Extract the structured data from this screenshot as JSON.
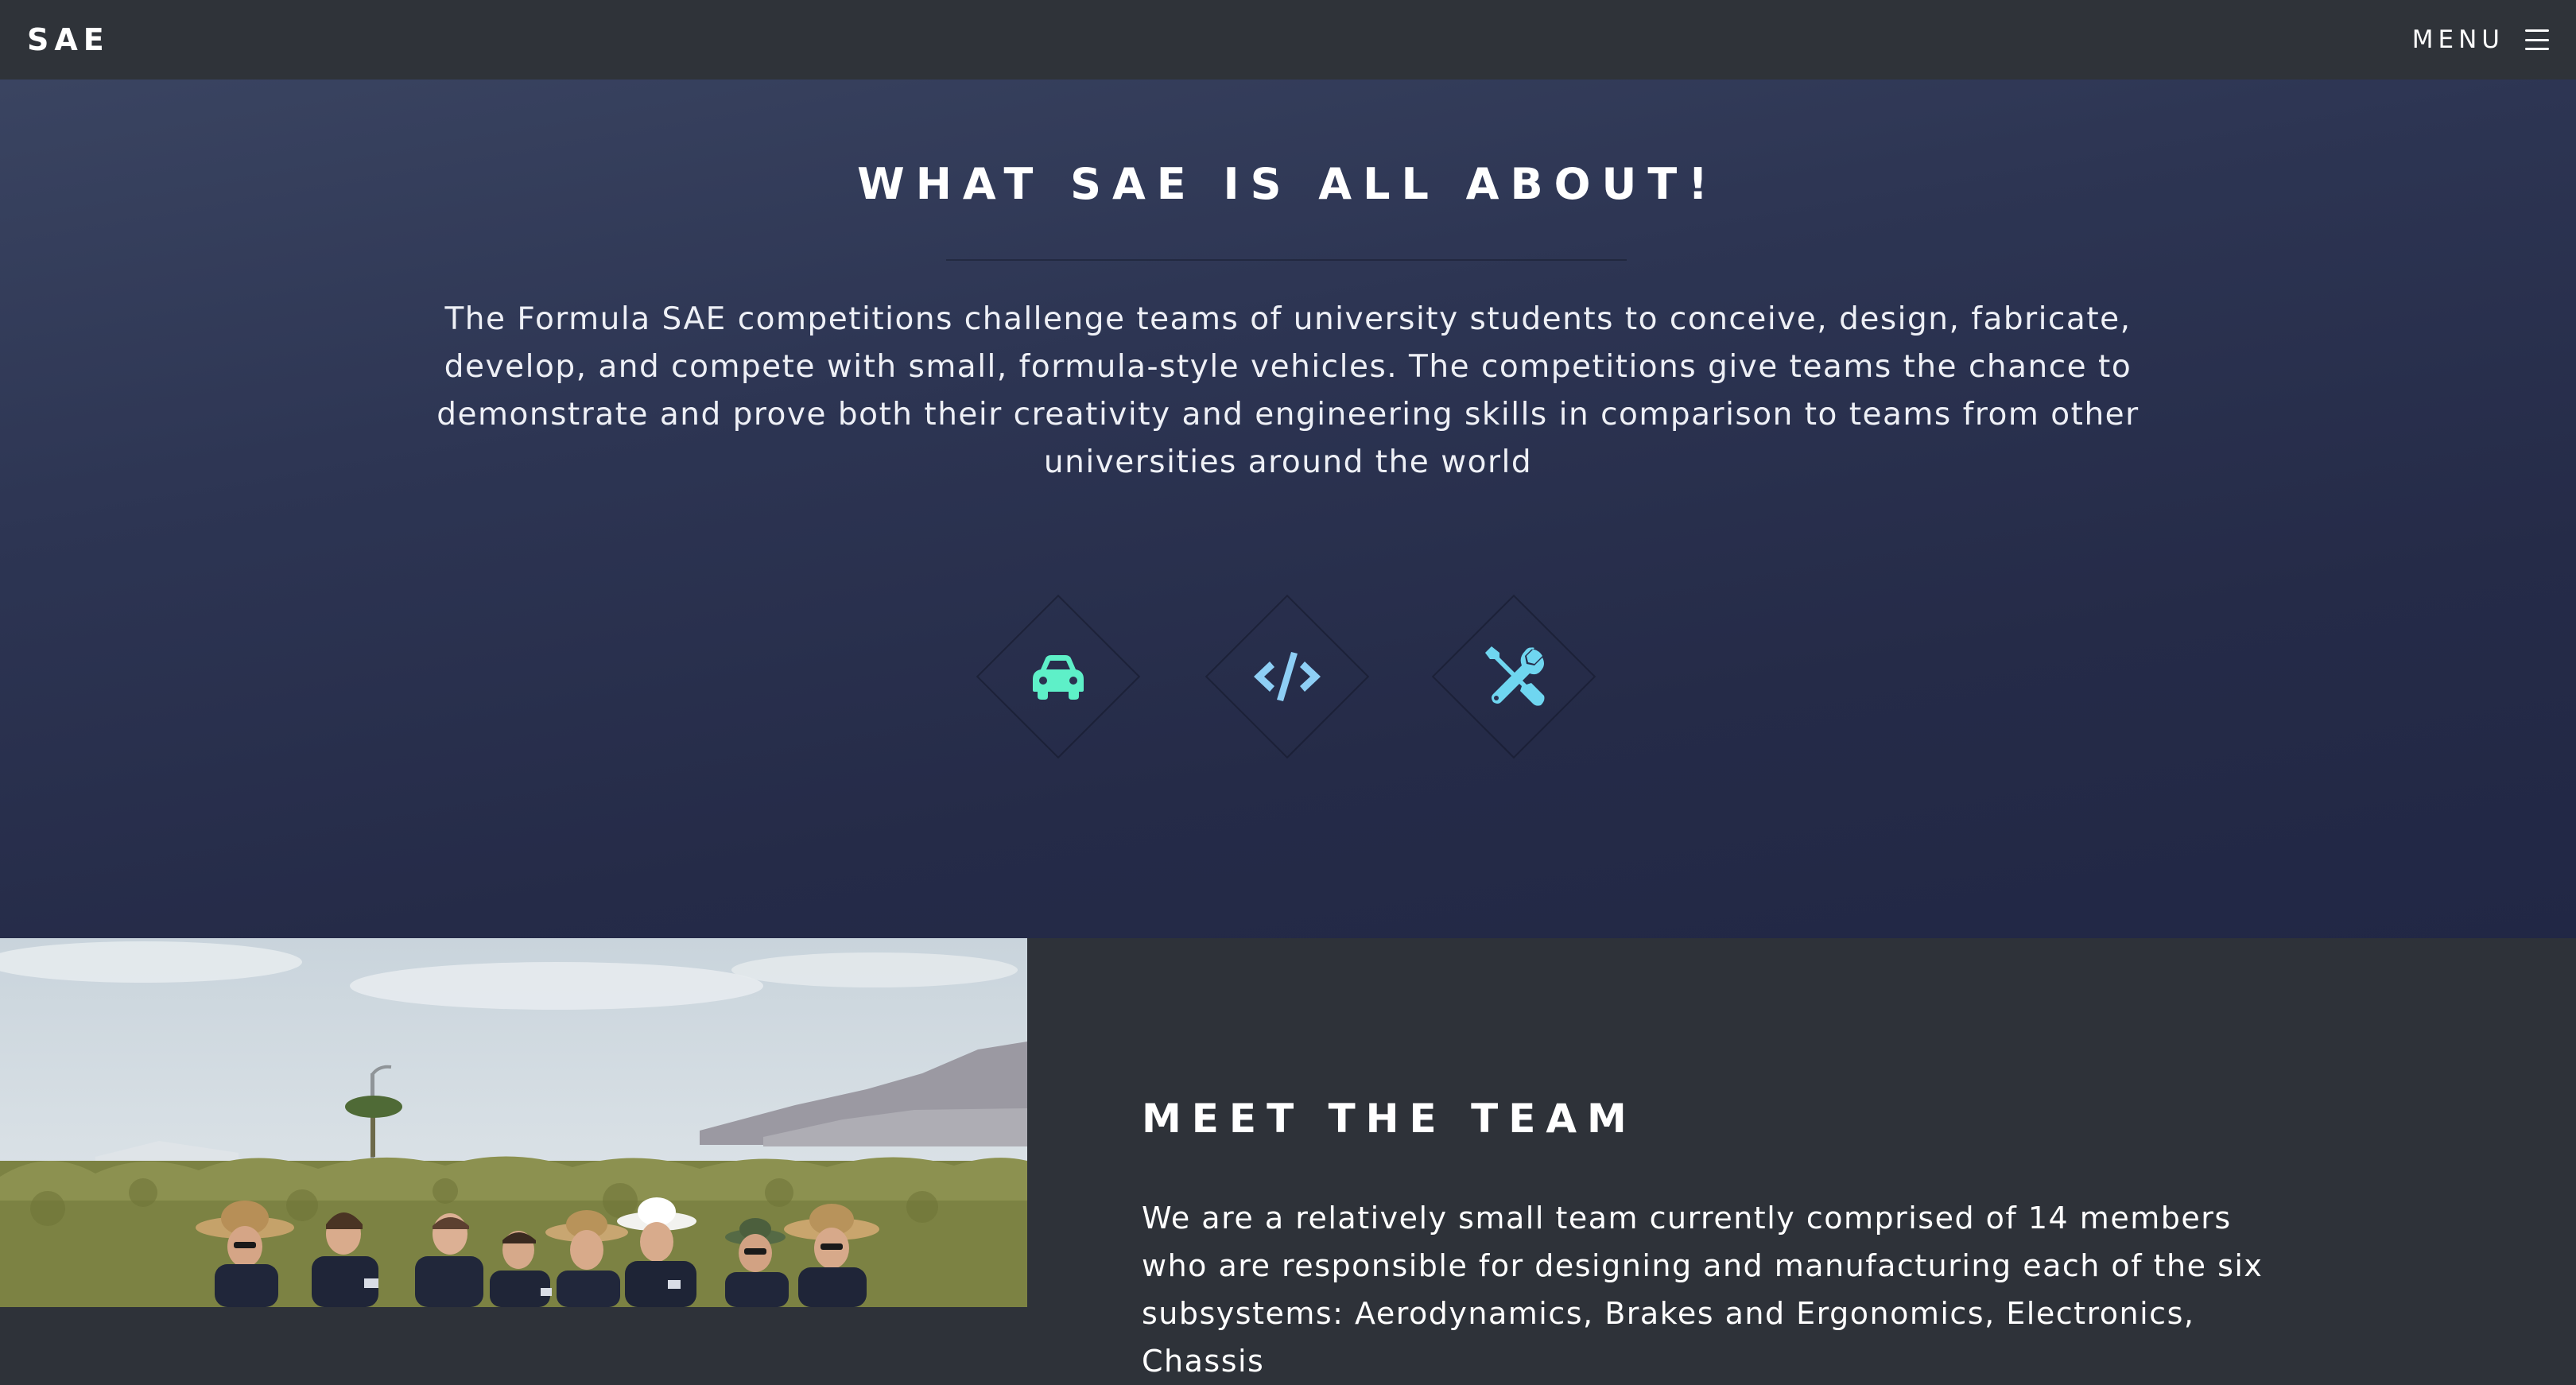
{
  "header": {
    "logo": "SAE",
    "menu_label": "MENU"
  },
  "intro": {
    "title": "WHAT SAE IS ALL ABOUT!",
    "text": "The Formula SAE competitions challenge teams of university students to conceive, design, fabricate, develop, and compete with small, formula-style vehicles. The competitions give teams the chance to demonstrate and prove both their creativity and engineering skills in comparison to teams from other universities around the world",
    "icons": [
      {
        "name": "car-icon",
        "color": "#5ef0c8"
      },
      {
        "name": "code-icon",
        "color": "#8ecff5"
      },
      {
        "name": "tools-icon",
        "color": "#6fd6f0"
      }
    ]
  },
  "team": {
    "title": "MEET THE TEAM",
    "text": "We are a relatively small team currently comprised of 14 members who are responsible for designing and manufacturing each of the six subsystems: Aerodynamics, Brakes and Ergonomics, Electronics, Chassis"
  },
  "colors": {
    "header_bg": "#2f3339",
    "intro_bg_top": "#3a4461",
    "intro_bg_bottom": "#212745",
    "team_bg": "#2e3239"
  }
}
